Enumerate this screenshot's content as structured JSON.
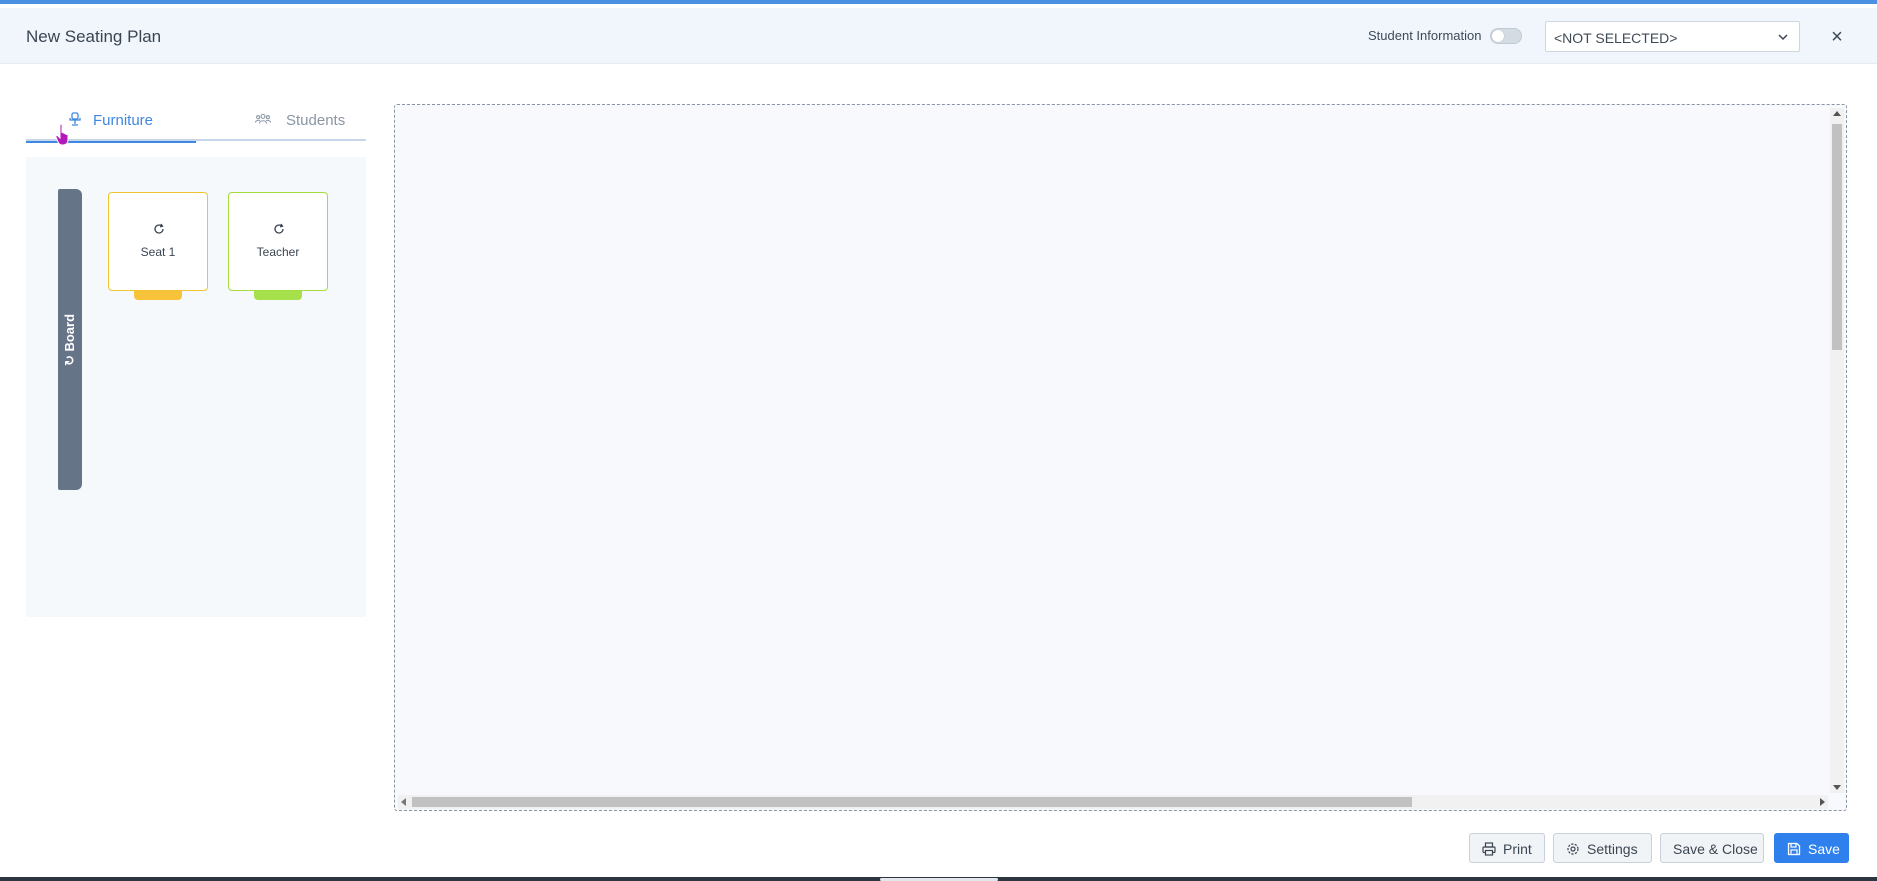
{
  "header": {
    "title": "New Seating Plan",
    "student_info_label": "Student Information",
    "student_info_enabled": false,
    "select_value": "<NOT SELECTED>",
    "close_label": "×"
  },
  "tabs": [
    {
      "label": "Furniture",
      "icon": "chair-icon",
      "active": true
    },
    {
      "label": "Students",
      "icon": "users-icon",
      "active": false
    }
  ],
  "palette": {
    "board_label": "Board",
    "seats": [
      {
        "label": "Seat 1",
        "color": "#f7c33a"
      },
      {
        "label": "Teacher",
        "color": "#a6e04a"
      }
    ]
  },
  "footer": {
    "print_label": "Print",
    "settings_label": "Settings",
    "save_close_label": "Save & Close",
    "save_label": "Save"
  },
  "colors": {
    "accent": "#2f80ed",
    "tab_active": "#3f87e0",
    "board": "#667488"
  }
}
